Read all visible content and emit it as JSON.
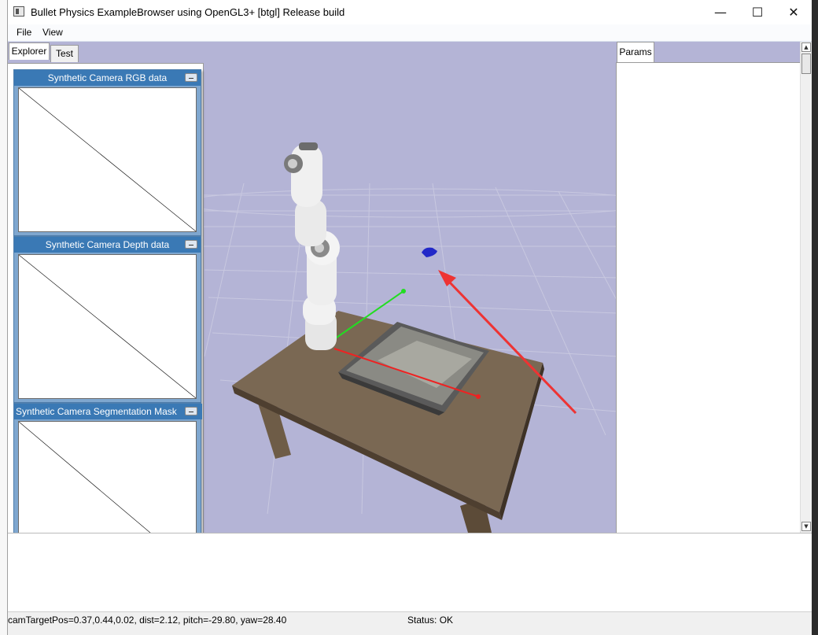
{
  "window": {
    "title": "Bullet Physics ExampleBrowser using OpenGL3+ [btgl] Release build",
    "minimize": "—",
    "maximize": "☐",
    "close": "✕"
  },
  "menu": {
    "items": [
      "File",
      "View"
    ]
  },
  "explorer": {
    "tabs": [
      {
        "label": "Explorer",
        "active": true
      },
      {
        "label": "Test",
        "active": false
      }
    ]
  },
  "camera_windows": [
    {
      "title": "Synthetic Camera RGB data"
    },
    {
      "title": "Synthetic Camera Depth data"
    },
    {
      "title": "Synthetic Camera Segmentation Mask"
    }
  ],
  "params": {
    "tab_label": "Params"
  },
  "status": {
    "camera": "camTargetPos=0.37,0.44,0.02, dist=2.12, pitch=-29.80, yaw=28.40",
    "state": "Status: OK"
  },
  "colors": {
    "viewport_bg": "#b4b4d6",
    "cam_title_bg": "#3a79b5",
    "annotation_arrow": "#ee3333"
  }
}
